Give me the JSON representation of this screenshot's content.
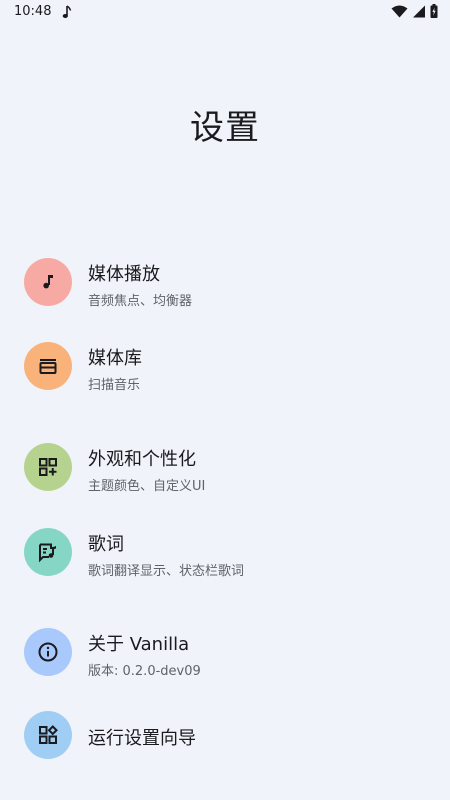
{
  "status_bar": {
    "time": "10:48",
    "icons": [
      "music-note-icon",
      "wifi-icon",
      "signal-icon",
      "battery-charging-icon"
    ]
  },
  "page": {
    "title": "设置"
  },
  "settings": {
    "items": [
      {
        "title": "媒体播放",
        "subtitle": "音频焦点、均衡器",
        "icon": "music-note-icon",
        "icon_bg": "#f7aaa3"
      },
      {
        "title": "媒体库",
        "subtitle": "扫描音乐",
        "icon": "library-icon",
        "icon_bg": "#f9b27a"
      },
      {
        "title": "外观和个性化",
        "subtitle": "主题颜色、自定义UI",
        "icon": "widgets-add-icon",
        "icon_bg": "#b5d38f"
      },
      {
        "title": "歌词",
        "subtitle": "歌词翻译显示、状态栏歌词",
        "icon": "lyrics-icon",
        "icon_bg": "#86d6c6"
      },
      {
        "title": "关于 Vanilla",
        "subtitle": "版本: 0.2.0-dev09",
        "icon": "info-icon",
        "icon_bg": "#a9c8fb"
      },
      {
        "title": "运行设置向导",
        "subtitle": "",
        "icon": "wizard-icon",
        "icon_bg": "#9fcdf3"
      }
    ]
  }
}
